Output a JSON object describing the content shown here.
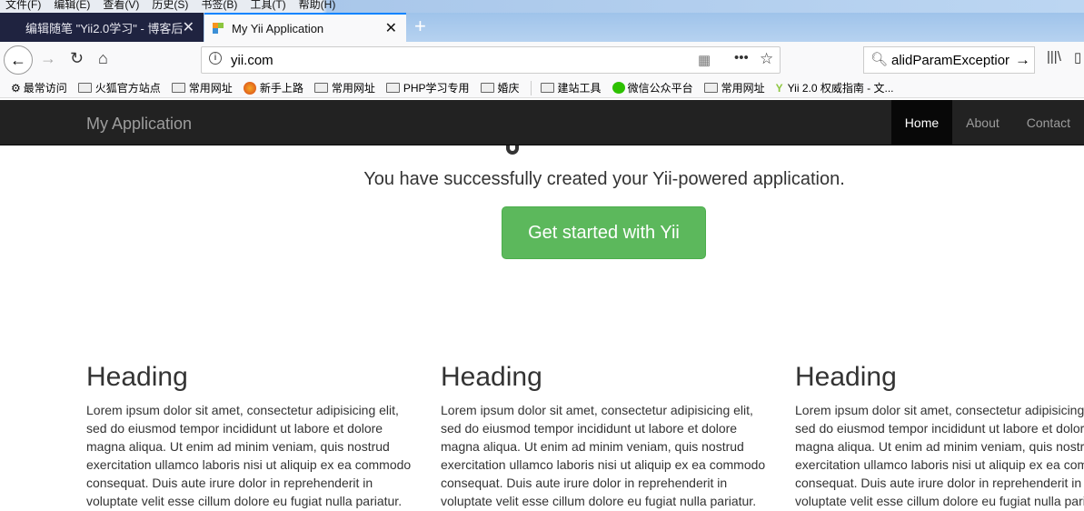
{
  "menu": [
    "文件(F)",
    "编辑(E)",
    "查看(V)",
    "历史(S)",
    "书签(B)",
    "工具(T)",
    "帮助(H)"
  ],
  "tabs": [
    {
      "label": "编辑随笔 \"Yii2.0学习\" - 博客后"
    },
    {
      "label": "My Yii Application"
    }
  ],
  "url": "yii.com",
  "search_value": "alidParamExceptior",
  "bookmarks": [
    "最常访问",
    "火狐官方站点",
    "常用网址",
    "新手上路",
    "常用网址",
    "PHP学习专用",
    "婚庆",
    "建站工具",
    "微信公众平台",
    "常用网址",
    "Yii 2.0 权威指南 - 文..."
  ],
  "navbar": {
    "brand": "My Application",
    "items": [
      "Home",
      "About",
      "Contact"
    ],
    "active": "Home"
  },
  "jumbotron": {
    "lead": "You have successfully created your Yii-powered application.",
    "button": "Get started with Yii"
  },
  "columns": [
    {
      "heading": "Heading",
      "body": "Lorem ipsum dolor sit amet, consectetur adipisicing elit, sed do eiusmod tempor incididunt ut labore et dolore magna aliqua. Ut enim ad minim veniam, quis nostrud exercitation ullamco laboris nisi ut aliquip ex ea commodo consequat. Duis aute irure dolor in reprehenderit in voluptate velit esse cillum dolore eu fugiat nulla pariatur."
    },
    {
      "heading": "Heading",
      "body": "Lorem ipsum dolor sit amet, consectetur adipisicing elit, sed do eiusmod tempor incididunt ut labore et dolore magna aliqua. Ut enim ad minim veniam, quis nostrud exercitation ullamco laboris nisi ut aliquip ex ea commodo consequat. Duis aute irure dolor in reprehenderit in voluptate velit esse cillum dolore eu fugiat nulla pariatur."
    },
    {
      "heading": "Heading",
      "body": "Lorem ipsum dolor sit amet, consectetur adipisicing elit, sed do eiusmod tempor incididunt ut labore et dolore magna aliqua. Ut enim ad minim veniam, quis nostrud exercitation ullamco laboris nisi ut aliquip ex ea commodo consequat. Duis aute irure dolor in reprehenderit in voluptate velit esse cillum dolore eu fugiat nulla pariatur."
    }
  ],
  "colors": {
    "navbar": "#222222",
    "button": "#5cb85c",
    "tab_accent": "#0a84ff"
  }
}
